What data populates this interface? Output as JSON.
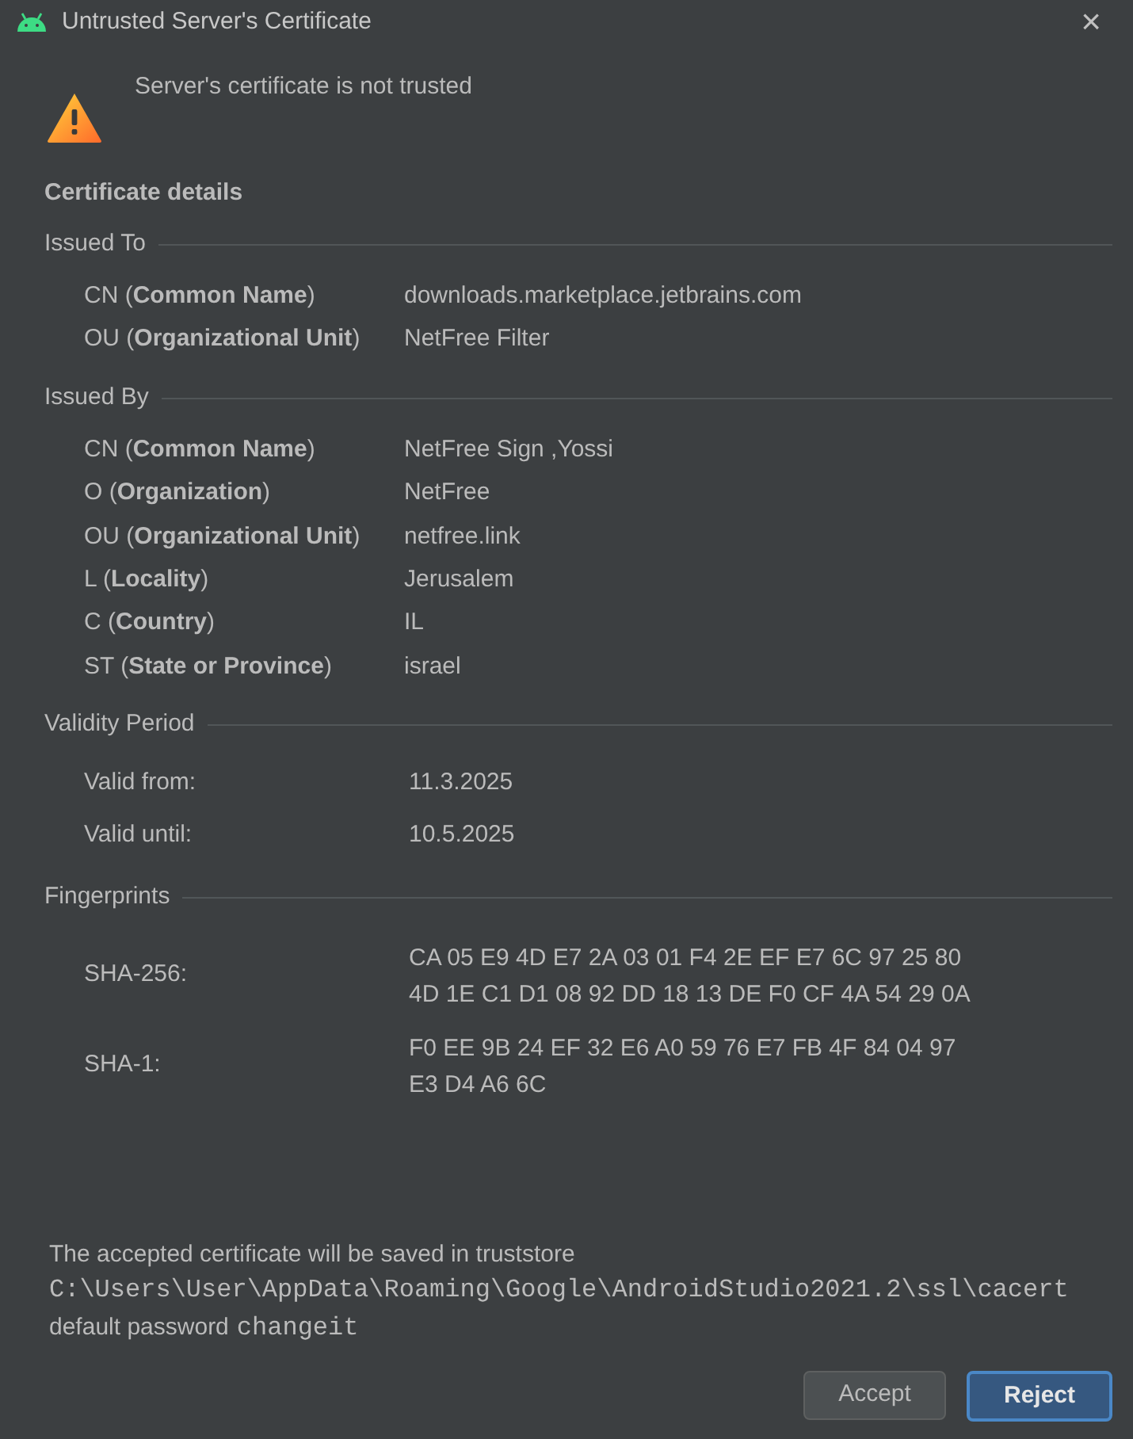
{
  "window": {
    "title": "Untrusted Server's Certificate",
    "close": "×"
  },
  "message": "Server's certificate is not trusted",
  "details_title": "Certificate details",
  "sections": [
    {
      "title": "Issued To",
      "kind": "fields",
      "rows": [
        {
          "label": "CN (**Common Name**)",
          "value": "downloads.marketplace.jetbrains.com"
        },
        {
          "label": "OU (**Organizational Unit**)",
          "value": "NetFree Filter"
        }
      ]
    },
    {
      "title": "Issued By",
      "kind": "fields",
      "rows": [
        {
          "label": "CN (**Common Name**)",
          "value": "NetFree Sign ,Yossi"
        },
        {
          "label": "O (**Organization**)",
          "value": "NetFree"
        },
        {
          "label": "OU (**Organizational Unit**)",
          "value": "netfree.link"
        },
        {
          "label": "L (**Locality**)",
          "value": "Jerusalem"
        },
        {
          "label": "C (**Country**)",
          "value": "IL"
        },
        {
          "label": "ST (**State or Province**)",
          "value": "israel"
        }
      ]
    },
    {
      "title": "Validity Period",
      "kind": "dates",
      "rows": [
        {
          "label": "Valid from:",
          "value": "11.3.2025"
        },
        {
          "label": "Valid until:",
          "value": "10.5.2025"
        }
      ]
    },
    {
      "title": "Fingerprints",
      "kind": "fingerprints",
      "rows": [
        {
          "label": "SHA-256:",
          "lines": [
            "CA 05 E9 4D E7 2A 03 01 F4 2E EF E7 6C 97 25 80",
            "4D 1E C1 D1 08 92 DD 18 13 DE F0 CF 4A 54 29 0A"
          ]
        },
        {
          "label": "SHA-1:",
          "lines": [
            "F0 EE 9B 24 EF 32 E6 A0 59 76 E7 FB 4F 84 04 97",
            "E3 D4 A6 6C"
          ]
        }
      ]
    }
  ],
  "footer": {
    "note": "The accepted certificate will be saved in truststore",
    "path": "C:\\Users\\User\\AppData\\Roaming\\Google\\AndroidStudio2021.2\\ssl\\cacert",
    "password_label": "default password",
    "password": "changeit"
  },
  "buttons": [
    {
      "label": "Accept",
      "default": false
    },
    {
      "label": "Reject",
      "default": true
    }
  ]
}
